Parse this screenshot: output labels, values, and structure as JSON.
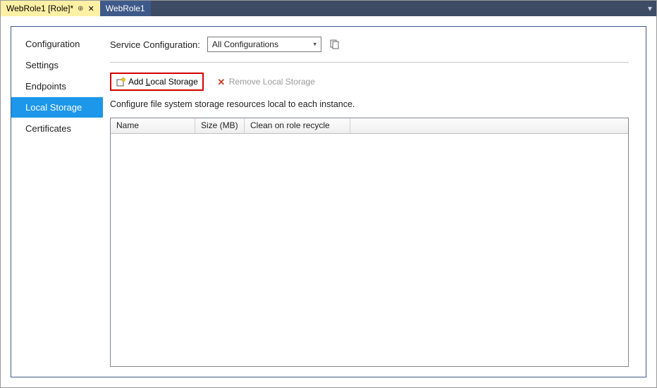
{
  "tabs": {
    "active": "WebRole1 [Role]*",
    "inactive": "WebRole1"
  },
  "sidebar": {
    "items": [
      {
        "label": "Configuration"
      },
      {
        "label": "Settings"
      },
      {
        "label": "Endpoints"
      },
      {
        "label": "Local Storage"
      },
      {
        "label": "Certificates"
      }
    ]
  },
  "config": {
    "label": "Service Configuration:",
    "selected": "All Configurations"
  },
  "toolbar": {
    "add": "Add Local Storage",
    "remove": "Remove Local Storage"
  },
  "description": "Configure file system storage resources local to each instance.",
  "grid": {
    "columns": {
      "name": "Name",
      "size": "Size (MB)",
      "clean": "Clean on role recycle"
    },
    "rows": []
  }
}
